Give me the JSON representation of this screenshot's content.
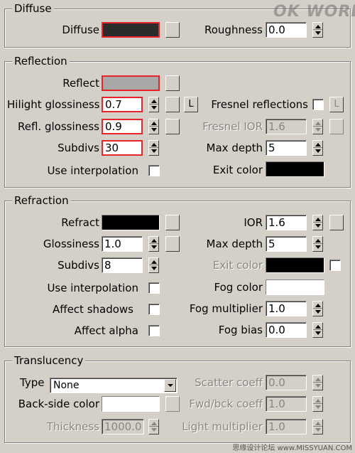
{
  "diffuse": {
    "title": "Diffuse",
    "diffuse_label": "Diffuse",
    "diffuse_color": "#2b2b2b",
    "roughness_label": "Roughness",
    "roughness_value": "0.0"
  },
  "reflection": {
    "title": "Reflection",
    "reflect_label": "Reflect",
    "reflect_color": "#a8a8a8",
    "hilight_label": "Hilight glossiness",
    "hilight_value": "0.7",
    "l_button": "L",
    "fresnel_label": "Fresnel reflections",
    "refl_gloss_label": "Refl. glossiness",
    "refl_gloss_value": "0.9",
    "fresnel_ior_label": "Fresnel IOR",
    "fresnel_ior_value": "1.6",
    "subdivs_label": "Subdivs",
    "subdivs_value": "30",
    "max_depth_label": "Max depth",
    "max_depth_value": "5",
    "use_interp_label": "Use interpolation",
    "exit_color_label": "Exit color",
    "exit_color": "#000000"
  },
  "refraction": {
    "title": "Refraction",
    "refract_label": "Refract",
    "refract_color": "#000000",
    "ior_label": "IOR",
    "ior_value": "1.6",
    "glossiness_label": "Glossiness",
    "glossiness_value": "1.0",
    "max_depth_label": "Max depth",
    "max_depth_value": "5",
    "subdivs_label": "Subdivs",
    "subdivs_value": "8",
    "exit_color_label": "Exit color",
    "exit_color": "#000000",
    "use_interp_label": "Use interpolation",
    "fog_color_label": "Fog color",
    "fog_color": "#ffffff",
    "affect_shadows_label": "Affect shadows",
    "fog_multiplier_label": "Fog multiplier",
    "fog_multiplier_value": "1.0",
    "affect_alpha_label": "Affect alpha",
    "fog_bias_label": "Fog bias",
    "fog_bias_value": "0.0"
  },
  "translucency": {
    "title": "Translucency",
    "type_label": "Type",
    "type_value": "None",
    "scatter_label": "Scatter coeff",
    "scatter_value": "0.0",
    "backside_label": "Back-side color",
    "backside_color": "#ffffff",
    "fwd_label": "Fwd/bck coeff",
    "fwd_value": "1.0",
    "thickness_label": "Thickness",
    "thickness_value": "1000.0",
    "light_mult_label": "Light multiplier",
    "light_mult_value": "1.0"
  },
  "watermarks": {
    "logo": "OK WORLD",
    "bottom": "思缘设计论坛 www.MISSYUAN.COM"
  },
  "colors": {
    "highlight": "#e8232a",
    "panel_bg": "#d4d0c8",
    "disabled_text": "#8a8782"
  }
}
